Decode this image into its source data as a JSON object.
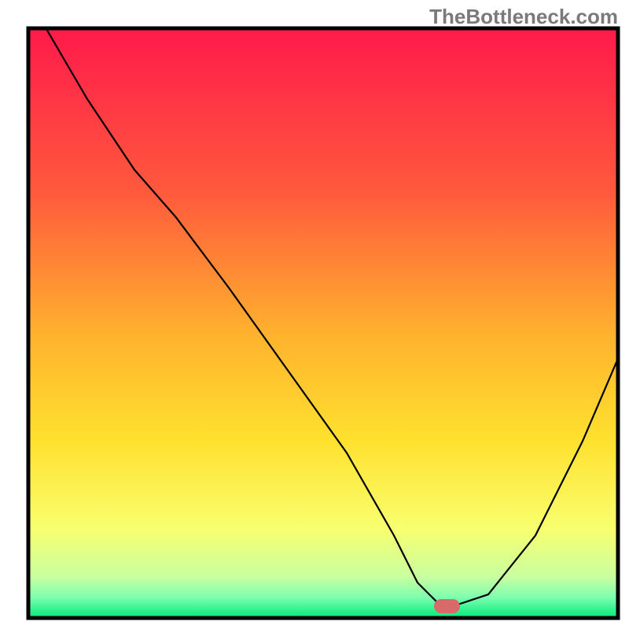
{
  "watermark": "TheBottleneck.com",
  "chart_data": {
    "type": "line",
    "title": "",
    "xlabel": "",
    "ylabel": "",
    "xlim": [
      0,
      100
    ],
    "ylim": [
      0,
      100
    ],
    "grid": false,
    "legend": false,
    "background_gradient_stops": [
      {
        "offset": 0.0,
        "color": "#ff1a4b"
      },
      {
        "offset": 0.28,
        "color": "#ff5a3c"
      },
      {
        "offset": 0.52,
        "color": "#ffb22e"
      },
      {
        "offset": 0.7,
        "color": "#ffe12e"
      },
      {
        "offset": 0.85,
        "color": "#f8ff70"
      },
      {
        "offset": 0.93,
        "color": "#c9ffa0"
      },
      {
        "offset": 0.965,
        "color": "#7dffb0"
      },
      {
        "offset": 1.0,
        "color": "#00ea7a"
      }
    ],
    "frame_color": "#000000",
    "series": [
      {
        "name": "bottleneck-curve",
        "color": "#000000",
        "x": [
          3,
          10,
          18,
          25,
          34,
          44,
          54,
          62,
          66,
          70,
          72,
          78,
          86,
          94,
          100
        ],
        "y": [
          100,
          88,
          76,
          68,
          56,
          42,
          28,
          14,
          6,
          2,
          2,
          4,
          14,
          30,
          44
        ]
      }
    ],
    "marker": {
      "name": "optimal-marker",
      "color": "#d86a6a",
      "x": 71,
      "y": 2,
      "rx": 2.2,
      "ry": 1.2
    }
  }
}
